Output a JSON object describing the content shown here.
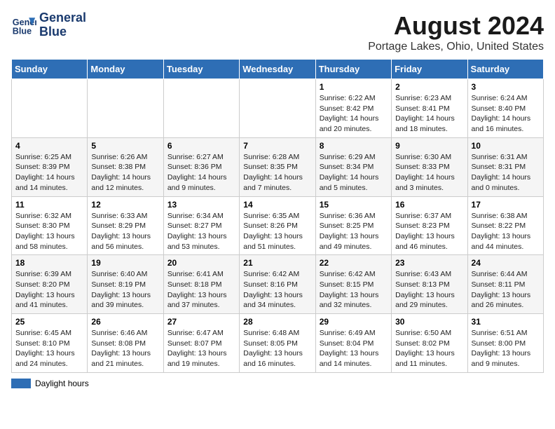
{
  "header": {
    "logo_line1": "General",
    "logo_line2": "Blue",
    "title": "August 2024",
    "subtitle": "Portage Lakes, Ohio, United States"
  },
  "weekdays": [
    "Sunday",
    "Monday",
    "Tuesday",
    "Wednesday",
    "Thursday",
    "Friday",
    "Saturday"
  ],
  "legend": {
    "label": "Daylight hours",
    "color": "#2e6eb5"
  },
  "weeks": [
    [
      {
        "day": "",
        "info": ""
      },
      {
        "day": "",
        "info": ""
      },
      {
        "day": "",
        "info": ""
      },
      {
        "day": "",
        "info": ""
      },
      {
        "day": "1",
        "info": "Sunrise: 6:22 AM\nSunset: 8:42 PM\nDaylight: 14 hours and 20 minutes."
      },
      {
        "day": "2",
        "info": "Sunrise: 6:23 AM\nSunset: 8:41 PM\nDaylight: 14 hours and 18 minutes."
      },
      {
        "day": "3",
        "info": "Sunrise: 6:24 AM\nSunset: 8:40 PM\nDaylight: 14 hours and 16 minutes."
      }
    ],
    [
      {
        "day": "4",
        "info": "Sunrise: 6:25 AM\nSunset: 8:39 PM\nDaylight: 14 hours and 14 minutes."
      },
      {
        "day": "5",
        "info": "Sunrise: 6:26 AM\nSunset: 8:38 PM\nDaylight: 14 hours and 12 minutes."
      },
      {
        "day": "6",
        "info": "Sunrise: 6:27 AM\nSunset: 8:36 PM\nDaylight: 14 hours and 9 minutes."
      },
      {
        "day": "7",
        "info": "Sunrise: 6:28 AM\nSunset: 8:35 PM\nDaylight: 14 hours and 7 minutes."
      },
      {
        "day": "8",
        "info": "Sunrise: 6:29 AM\nSunset: 8:34 PM\nDaylight: 14 hours and 5 minutes."
      },
      {
        "day": "9",
        "info": "Sunrise: 6:30 AM\nSunset: 8:33 PM\nDaylight: 14 hours and 3 minutes."
      },
      {
        "day": "10",
        "info": "Sunrise: 6:31 AM\nSunset: 8:31 PM\nDaylight: 14 hours and 0 minutes."
      }
    ],
    [
      {
        "day": "11",
        "info": "Sunrise: 6:32 AM\nSunset: 8:30 PM\nDaylight: 13 hours and 58 minutes."
      },
      {
        "day": "12",
        "info": "Sunrise: 6:33 AM\nSunset: 8:29 PM\nDaylight: 13 hours and 56 minutes."
      },
      {
        "day": "13",
        "info": "Sunrise: 6:34 AM\nSunset: 8:27 PM\nDaylight: 13 hours and 53 minutes."
      },
      {
        "day": "14",
        "info": "Sunrise: 6:35 AM\nSunset: 8:26 PM\nDaylight: 13 hours and 51 minutes."
      },
      {
        "day": "15",
        "info": "Sunrise: 6:36 AM\nSunset: 8:25 PM\nDaylight: 13 hours and 49 minutes."
      },
      {
        "day": "16",
        "info": "Sunrise: 6:37 AM\nSunset: 8:23 PM\nDaylight: 13 hours and 46 minutes."
      },
      {
        "day": "17",
        "info": "Sunrise: 6:38 AM\nSunset: 8:22 PM\nDaylight: 13 hours and 44 minutes."
      }
    ],
    [
      {
        "day": "18",
        "info": "Sunrise: 6:39 AM\nSunset: 8:20 PM\nDaylight: 13 hours and 41 minutes."
      },
      {
        "day": "19",
        "info": "Sunrise: 6:40 AM\nSunset: 8:19 PM\nDaylight: 13 hours and 39 minutes."
      },
      {
        "day": "20",
        "info": "Sunrise: 6:41 AM\nSunset: 8:18 PM\nDaylight: 13 hours and 37 minutes."
      },
      {
        "day": "21",
        "info": "Sunrise: 6:42 AM\nSunset: 8:16 PM\nDaylight: 13 hours and 34 minutes."
      },
      {
        "day": "22",
        "info": "Sunrise: 6:42 AM\nSunset: 8:15 PM\nDaylight: 13 hours and 32 minutes."
      },
      {
        "day": "23",
        "info": "Sunrise: 6:43 AM\nSunset: 8:13 PM\nDaylight: 13 hours and 29 minutes."
      },
      {
        "day": "24",
        "info": "Sunrise: 6:44 AM\nSunset: 8:11 PM\nDaylight: 13 hours and 26 minutes."
      }
    ],
    [
      {
        "day": "25",
        "info": "Sunrise: 6:45 AM\nSunset: 8:10 PM\nDaylight: 13 hours and 24 minutes."
      },
      {
        "day": "26",
        "info": "Sunrise: 6:46 AM\nSunset: 8:08 PM\nDaylight: 13 hours and 21 minutes."
      },
      {
        "day": "27",
        "info": "Sunrise: 6:47 AM\nSunset: 8:07 PM\nDaylight: 13 hours and 19 minutes."
      },
      {
        "day": "28",
        "info": "Sunrise: 6:48 AM\nSunset: 8:05 PM\nDaylight: 13 hours and 16 minutes."
      },
      {
        "day": "29",
        "info": "Sunrise: 6:49 AM\nSunset: 8:04 PM\nDaylight: 13 hours and 14 minutes."
      },
      {
        "day": "30",
        "info": "Sunrise: 6:50 AM\nSunset: 8:02 PM\nDaylight: 13 hours and 11 minutes."
      },
      {
        "day": "31",
        "info": "Sunrise: 6:51 AM\nSunset: 8:00 PM\nDaylight: 13 hours and 9 minutes."
      }
    ]
  ]
}
